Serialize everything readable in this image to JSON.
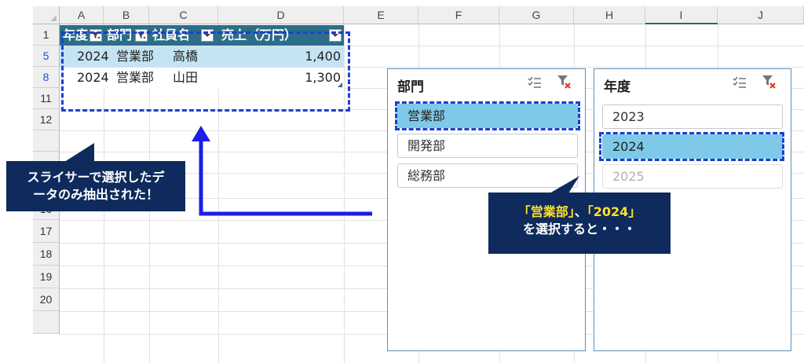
{
  "columns": [
    "A",
    "B",
    "C",
    "D",
    "E",
    "F",
    "G",
    "H",
    "I",
    "J"
  ],
  "rows": [
    "1",
    "5",
    "8",
    "11",
    "12",
    "",
    "",
    "16",
    "17",
    "18",
    "19",
    "20",
    ""
  ],
  "table": {
    "headers": [
      "年度",
      "部門",
      "社員名",
      "売上（万円）"
    ],
    "data": [
      [
        "2024",
        "営業部",
        "高橋",
        "1,400"
      ],
      [
        "2024",
        "営業部",
        "山田",
        "1,300"
      ]
    ]
  },
  "slicer_dept": {
    "title": "部門",
    "items": [
      "営業部",
      "開発部",
      "総務部"
    ],
    "selected": "営業部"
  },
  "slicer_year": {
    "title": "年度",
    "items": [
      "2023",
      "2024",
      "2025"
    ],
    "selected": "2024"
  },
  "callout_left": {
    "line1": "スライサーで選択したデ",
    "line2": "ータのみ抽出された！"
  },
  "callout_right": {
    "q1": "「営業部」",
    "sep": "、",
    "q2": "「2024」",
    "line2": "を選択すると・・・"
  },
  "colors": {
    "table_header": "#2c6e8a",
    "row_highlight": "#c5e4f3",
    "slicer_selected": "#7fc9e8",
    "dash": "#1a3fd0",
    "callout_bg": "#0f2a5c",
    "callout_highlight": "#ffe12a"
  }
}
